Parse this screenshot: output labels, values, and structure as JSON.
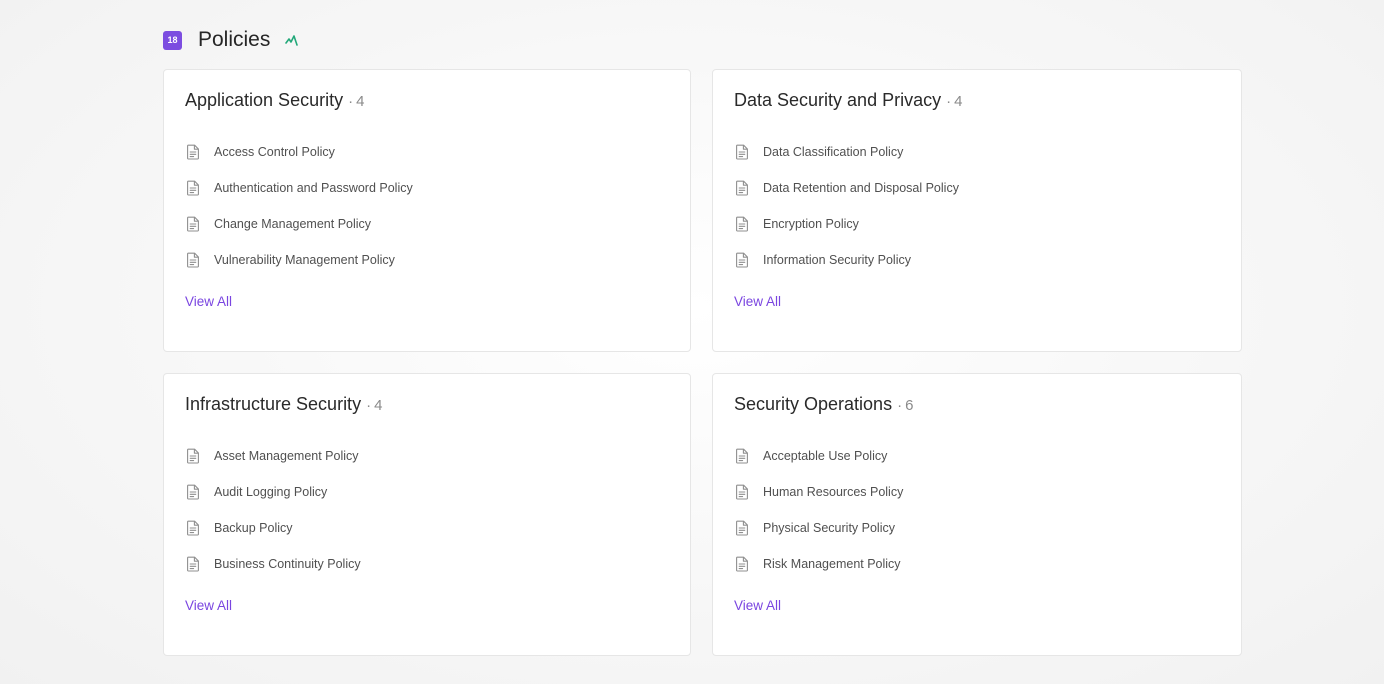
{
  "header": {
    "badge_count": "18",
    "title": "Policies",
    "trend_icon": "trend-up-icon",
    "trend_color": "#22a879"
  },
  "colors": {
    "accent": "#7c4de0",
    "link": "#7a45e0"
  },
  "groups": [
    {
      "title": "Application Security",
      "separator": "·",
      "count": "4",
      "items": [
        {
          "label": "Access Control Policy",
          "icon": "document-icon"
        },
        {
          "label": "Authentication and Password Policy",
          "icon": "document-icon"
        },
        {
          "label": "Change Management Policy",
          "icon": "document-icon"
        },
        {
          "label": "Vulnerability Management Policy",
          "icon": "document-icon"
        }
      ],
      "view_all_label": "View All"
    },
    {
      "title": "Data Security and Privacy",
      "separator": "·",
      "count": "4",
      "items": [
        {
          "label": "Data Classification Policy",
          "icon": "document-icon"
        },
        {
          "label": "Data Retention and Disposal Policy",
          "icon": "document-icon"
        },
        {
          "label": "Encryption Policy",
          "icon": "document-icon"
        },
        {
          "label": "Information Security Policy",
          "icon": "document-icon"
        }
      ],
      "view_all_label": "View All"
    },
    {
      "title": "Infrastructure Security",
      "separator": "·",
      "count": "4",
      "items": [
        {
          "label": "Asset Management Policy",
          "icon": "document-icon"
        },
        {
          "label": "Audit Logging Policy",
          "icon": "document-icon"
        },
        {
          "label": "Backup Policy",
          "icon": "document-icon"
        },
        {
          "label": "Business Continuity Policy",
          "icon": "document-icon"
        }
      ],
      "view_all_label": "View All"
    },
    {
      "title": "Security Operations",
      "separator": "·",
      "count": "6",
      "items": [
        {
          "label": "Acceptable Use Policy",
          "icon": "document-icon"
        },
        {
          "label": "Human Resources Policy",
          "icon": "document-icon"
        },
        {
          "label": "Physical Security Policy",
          "icon": "document-icon"
        },
        {
          "label": "Risk Management Policy",
          "icon": "document-icon"
        }
      ],
      "view_all_label": "View All"
    }
  ]
}
